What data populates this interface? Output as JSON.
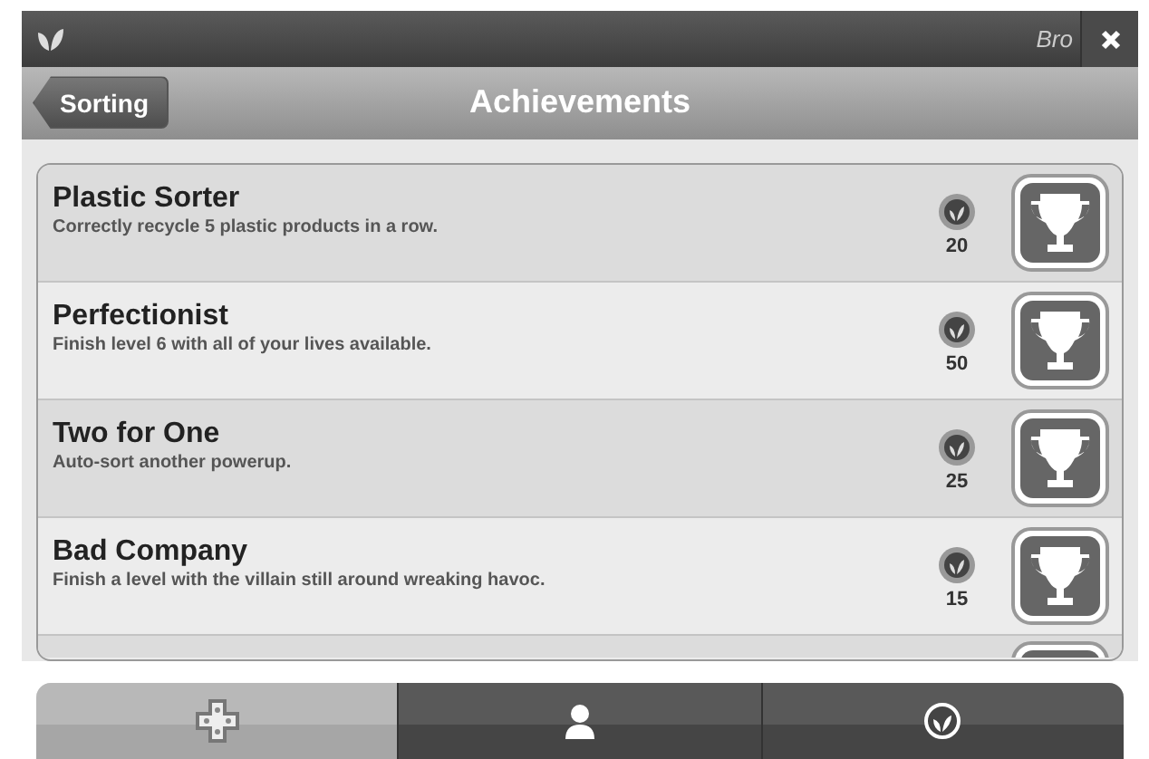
{
  "top_bar": {
    "title": "Bro"
  },
  "header": {
    "back_button": "Sorting",
    "title": "Achievements"
  },
  "achievements": [
    {
      "title": "Plastic Sorter",
      "description": "Correctly recycle 5 plastic products in a row.",
      "points": "20"
    },
    {
      "title": "Perfectionist",
      "description": "Finish level 6 with all of your lives available.",
      "points": "50"
    },
    {
      "title": "Two for One",
      "description": "Auto-sort another powerup.",
      "points": "25"
    },
    {
      "title": "Bad Company",
      "description": "Finish a level with the villain still around wreaking havoc.",
      "points": "15"
    }
  ],
  "tabs": [
    {
      "kind": "game",
      "selected": true
    },
    {
      "kind": "profile",
      "selected": false
    },
    {
      "kind": "achievements",
      "selected": false
    }
  ]
}
